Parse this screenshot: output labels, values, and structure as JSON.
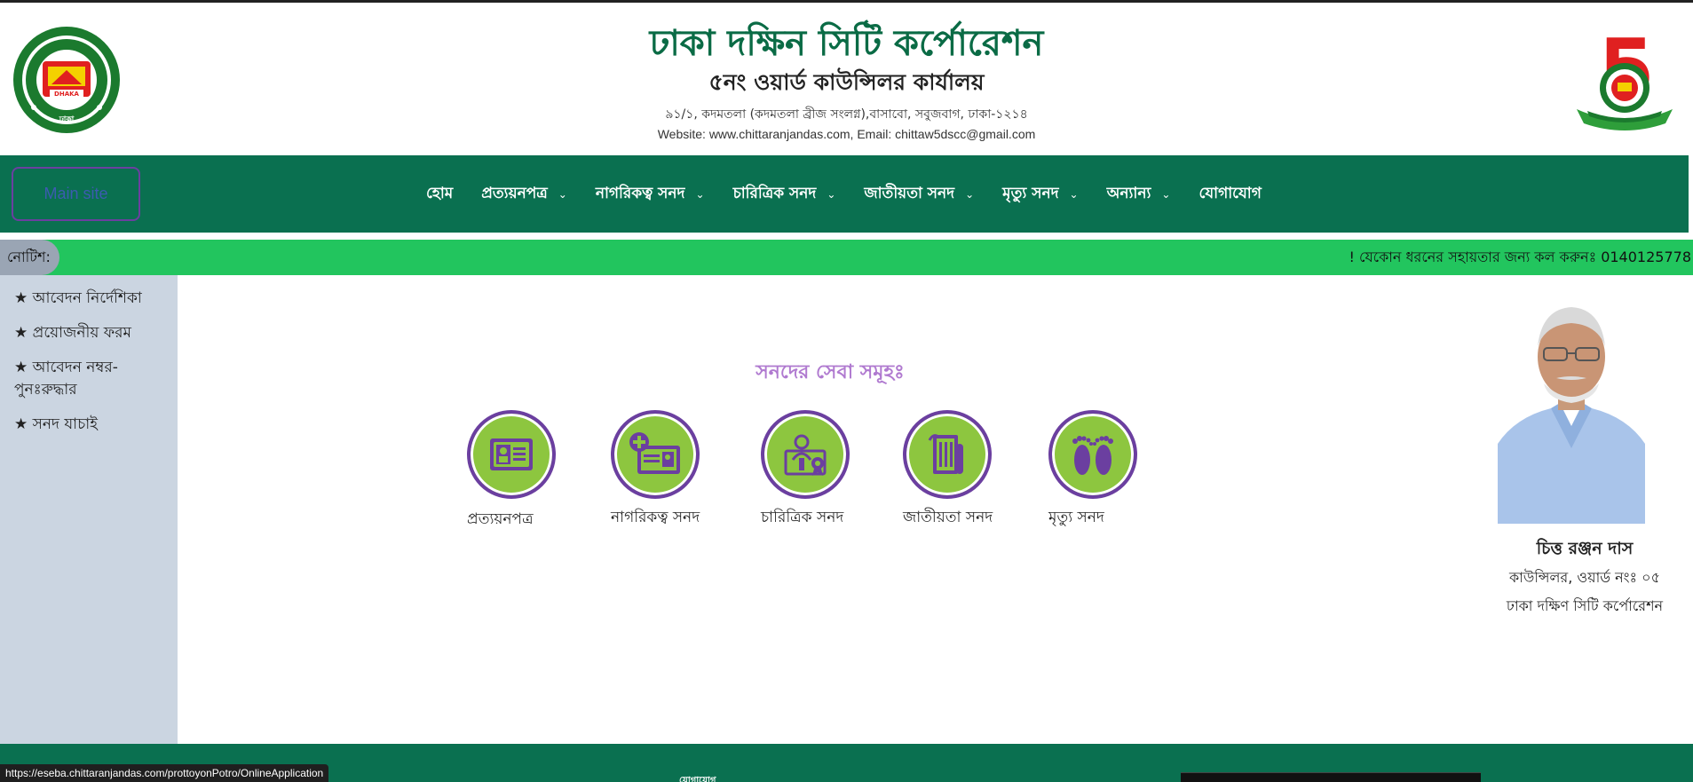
{
  "header": {
    "title": "ঢাকা দক্ষিন সিটি কর্পোরেশন",
    "subtitle": "৫নং ওয়ার্ড কাউন্সিলর কার্যালয়",
    "address": "৯১/১, কদমতলা (কদমতলা ব্রীজ সংলগ্ন),বাসাবো, সবুজবাগ, ঢাকা-১২১৪",
    "website": "Website: www.chittaranjandas.com, Email: chittaw5dscc@gmail.com",
    "logo_text": "DHAKA",
    "logo_bottom_text": "ঢাকা",
    "badge_number": "5"
  },
  "nav": {
    "main_site": "Main site",
    "items": [
      {
        "label": "হোম",
        "dropdown": false
      },
      {
        "label": "প্রত্যয়নপত্র",
        "dropdown": true
      },
      {
        "label": "নাগরিকত্ব সনদ",
        "dropdown": true
      },
      {
        "label": "চারিত্রিক সনদ",
        "dropdown": true
      },
      {
        "label": "জাতীয়তা সনদ",
        "dropdown": true
      },
      {
        "label": "মৃত্যু সনদ",
        "dropdown": true
      },
      {
        "label": "অন্যান্য",
        "dropdown": true
      },
      {
        "label": "যোগাযোগ",
        "dropdown": false
      }
    ],
    "chevron": "⌄"
  },
  "notice": {
    "label": "নোটিশ:",
    "text": "! যেকোন ধরনের সহায়তার জন্য কল করুনঃ 0140125778"
  },
  "sidebar": {
    "items": [
      "★ আবেদন নির্দেশিকা",
      "★ প্রয়োজনীয় ফরম",
      "★ আবেদন নম্বর-পুনঃরুদ্ধার",
      "★ সনদ যাচাই"
    ]
  },
  "services": {
    "title": "সনদের সেবা সমূহঃ",
    "items": [
      {
        "label": "প্রত্যয়নপত্র",
        "icon": "id-card-icon"
      },
      {
        "label": "নাগরিকত্ব সনদ",
        "icon": "add-id-card-icon"
      },
      {
        "label": "চারিত্রিক সনদ",
        "icon": "certificate-person-icon"
      },
      {
        "label": "জাতীয়তা সনদ",
        "icon": "scroll-document-icon"
      },
      {
        "label": "মৃত্যু সনদ",
        "icon": "footprints-icon"
      }
    ]
  },
  "councillor": {
    "name": "চিত্ত রঞ্জন দাস",
    "role": "কাউন্সিলর, ওয়ার্ড নংঃ ০৫",
    "org": "ঢাকা দক্ষিণ সিটি কর্পোরেশন"
  },
  "footer": {
    "heading": "যোগাযোগ"
  },
  "status_url": "https://eseba.chittaranjandas.com/prottoyonPotro/OnlineApplication",
  "colors": {
    "primary_green": "#0a7050",
    "title_green": "#0a6b45",
    "notice_green": "#22c55e",
    "sidebar_bg": "#cbd5e1",
    "service_green": "#8dc63f",
    "service_purple": "#6b3fa0",
    "services_title": "#b07ad0"
  }
}
